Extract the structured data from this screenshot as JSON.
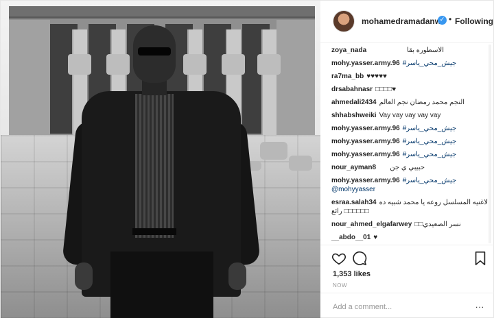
{
  "post": {
    "image_alt": "Black and white photo of a man in a suit and sunglasses standing in front of an ancient Egyptian temple"
  },
  "header": {
    "username": "mohamedramadanws",
    "verified": "✓",
    "separator": "•",
    "follow_status": "Following"
  },
  "comments": [
    {
      "user": "zoya_nada",
      "text": "الاسطوره بقا",
      "rtl": true
    },
    {
      "user": "mohy.yasser.army.96",
      "text": "#جيش_محي_ياسر",
      "link": true
    },
    {
      "user": "ra7ma_bb",
      "text": "♥♥♥♥♥"
    },
    {
      "user": "drsabahnasr",
      "text": "□□□□♥"
    },
    {
      "user": "ahmedali2434",
      "text": "النجم محمد رمضان نجم العالم",
      "rtl": true
    },
    {
      "user": "shhabshweiki",
      "text": "Vay vay vay vay vay"
    },
    {
      "user": "mohy.yasser.army.96",
      "text": "#جيش_محي_ياسر",
      "link": true
    },
    {
      "user": "mohy.yasser.army.96",
      "text": "#جيش_محي_ياسر",
      "link": true
    },
    {
      "user": "mohy.yasser.army.96",
      "text": "#جيش_محي_ياسر",
      "link": true
    },
    {
      "user": "nour_ayman8",
      "text": "حبيبي ي جن",
      "rtl": true
    },
    {
      "user": "mohy.yasser.army.96",
      "text": "#جيش_محي_ياسر",
      "link": true
    },
    {
      "user": "",
      "text": "@mohyyasser",
      "link": true
    },
    {
      "user": "esraa.salah34",
      "text": "الاغنيه المسلسل روعه يا محمد شبيه ده",
      "rtl": true
    },
    {
      "user": "",
      "text": "رائع □□□□□□"
    },
    {
      "user": "nour_ahmed_elgafarwey",
      "text": "□□نسر الصعيدي"
    },
    {
      "user": "__abdo__01",
      "text": "♥"
    }
  ],
  "actions": {
    "like_icon": "heart-icon",
    "comment_icon": "comment-icon",
    "save_icon": "bookmark-icon",
    "likes_text": "1,353 likes",
    "timestamp": "NOW"
  },
  "add_comment": {
    "placeholder": "Add a comment...",
    "more": "..."
  },
  "colors": {
    "link": "#003569",
    "verified": "#3897f0",
    "border": "#efefef",
    "muted": "#999999"
  }
}
